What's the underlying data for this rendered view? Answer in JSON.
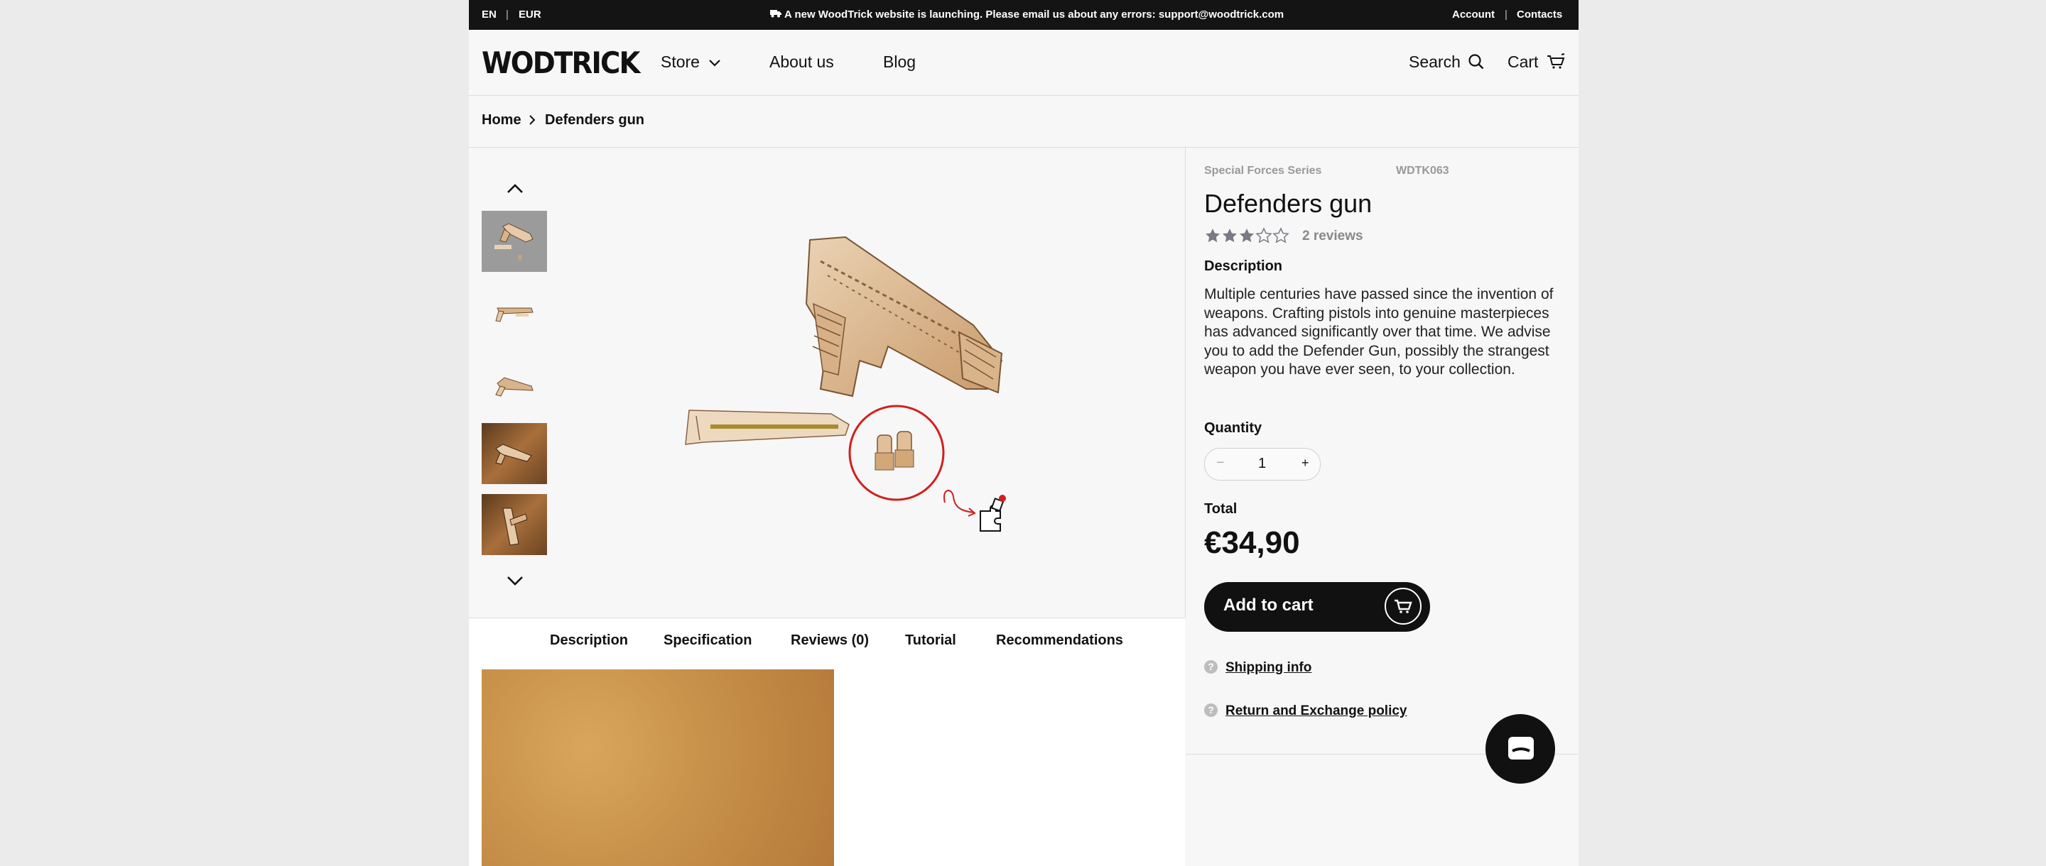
{
  "topbar": {
    "lang": "EN",
    "currency": "EUR",
    "announcement": "A new WoodTrick website is launching. Please email us about any errors: support@woodtrick.com",
    "account": "Account",
    "contacts": "Contacts"
  },
  "header": {
    "logo": "WODTRICK",
    "nav": [
      "Store",
      "About us",
      "Blog"
    ],
    "search": "Search",
    "cart": "Cart"
  },
  "breadcrumb": {
    "home": "Home",
    "current": "Defenders gun"
  },
  "gallery": {
    "thumbnail_count": 5,
    "active_thumbnail": 1
  },
  "tabs": [
    "Description",
    "Specification",
    "Reviews (0)",
    "Tutorial",
    "Recommendations"
  ],
  "product": {
    "series": "Special Forces Series",
    "sku": "WDTK063",
    "title": "Defenders gun",
    "rating": 3,
    "rating_max": 5,
    "reviews": "2 reviews",
    "description_label": "Description",
    "description": "Multiple centuries have passed since the invention of weapons. Crafting pistols into genuine masterpieces has advanced significantly over that time. We advise you to add the Defender Gun, possibly the strangest weapon you have ever seen, to your collection.",
    "quantity_label": "Quantity",
    "quantity": "1",
    "minus": "−",
    "plus": "+",
    "total_label": "Total",
    "total": "€34,90",
    "add_to_cart": "Add to cart",
    "shipping": "Shipping info",
    "returns": "Return and Exchange policy"
  },
  "colors": {
    "accent": "#111111",
    "star": "#7a7a86",
    "circle": "#d21f1f"
  }
}
